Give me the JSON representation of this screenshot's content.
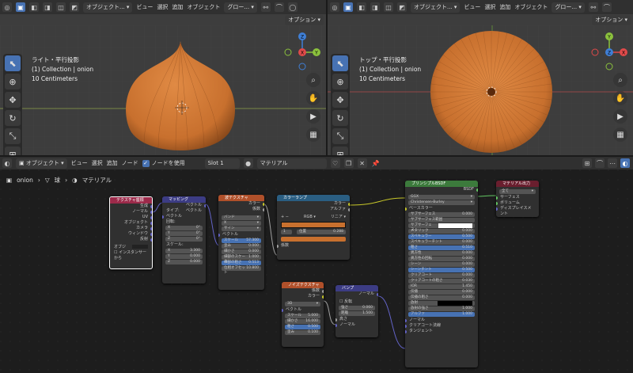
{
  "left_viewport": {
    "header": {
      "mode": "オブジェクト...",
      "menus": [
        "ビュー",
        "選択",
        "追加",
        "オブジェクト"
      ],
      "transform": "グロー...",
      "options": "オプション"
    },
    "info": [
      "ライト・平行投影",
      "(1) Collection | onion",
      "10 Centimeters"
    ],
    "gizmo_axes": [
      "Z",
      "Y",
      "X"
    ]
  },
  "right_viewport": {
    "header": {
      "mode": "オブジェクト...",
      "menus": [
        "ビュー",
        "選択",
        "追加",
        "オブジェクト"
      ],
      "transform": "グロー...",
      "options": "オプション"
    },
    "info": [
      "トップ・平行投影",
      "(1) Collection | onion",
      "10 Centimeters"
    ],
    "gizmo_axes": [
      "Y",
      "Z",
      "X"
    ]
  },
  "node_editor": {
    "header": {
      "mode": "オブジェクト",
      "menus": [
        "ビュー",
        "選択",
        "追加",
        "ノード"
      ],
      "use_nodes_label": "ノードを使用",
      "slot": "Slot 1",
      "material": "マテリアル"
    },
    "breadcrumb": [
      "onion",
      "球",
      "マテリアル"
    ],
    "nodes": {
      "texcoord": {
        "title": "テクスチャ座標",
        "outputs": [
          "生成",
          "ノーマル",
          "UV",
          "オブジェクト",
          "カメラ",
          "ウィンドウ",
          "反射"
        ],
        "object_label": "オブジ",
        "instancer": "インスタンサーから"
      },
      "mapping": {
        "title": "マッピング",
        "out": "ベクトル",
        "type_label": "タイプ:",
        "type_value": "ベクトル",
        "vector": "ベクトル",
        "rotation": "回転:",
        "rot": [
          [
            "X",
            "0°"
          ],
          [
            "Y",
            "0°"
          ],
          [
            "Z",
            "0°"
          ]
        ],
        "scale_label": "スケール:",
        "scale": [
          [
            "X",
            "3.300"
          ],
          [
            "Y",
            "0.000"
          ],
          [
            "Z",
            "0.000"
          ]
        ]
      },
      "wave": {
        "title": "波テクスチャ",
        "outs": [
          "カラー",
          "係数"
        ],
        "band": "バンド",
        "axis": "X",
        "profile": "サイン",
        "vector": "ベクトル",
        "fields": [
          [
            "スケール",
            "57.300"
          ],
          [
            "歪み",
            "0.000"
          ],
          [
            "細かさ",
            "0.000"
          ],
          [
            "細部のスケール",
            "1.000"
          ],
          [
            "細部の粗さ",
            "0.513"
          ],
          [
            "位相オフセット",
            "10.800"
          ]
        ]
      },
      "ramp": {
        "title": "カラーランプ",
        "outs": [
          "カラー",
          "アルファ"
        ],
        "mode": "RGB",
        "interp": "リニア",
        "stop_index": "1",
        "pos_label": "位置",
        "pos_value": "0.288",
        "fac": "係数"
      },
      "noise": {
        "title": "ノイズテクスチャ",
        "outs": [
          "係数",
          "カラー"
        ],
        "dim": "3D",
        "vector": "ベクトル",
        "fields": [
          [
            "スケール",
            "5.000"
          ],
          [
            "細かさ",
            "16.000"
          ],
          [
            "粗さ",
            "0.500"
          ],
          [
            "歪み",
            "0.100"
          ]
        ]
      },
      "bump": {
        "title": "バンプ",
        "out": "ノーマル",
        "invert": "反転",
        "fields": [
          [
            "強さ",
            "0.060"
          ],
          [
            "距離",
            "1.500"
          ]
        ],
        "inputs": [
          "高さ",
          "ノーマル"
        ]
      },
      "bsdf": {
        "title": "プリンシプルBSDF",
        "out": "BSDF",
        "dist": "GGX",
        "sss": "Christensen-Burley",
        "base_color": "ベースカラー",
        "fields": [
          [
            "サブサーフェス",
            "0.000"
          ],
          [
            "サブサーフェス範囲",
            ""
          ],
          [
            "サブサーフェス...",
            ""
          ],
          [
            "メタリック",
            "0.000"
          ],
          [
            "スペキュラー",
            "0.500"
          ],
          [
            "スペキュラーチント",
            "0.000"
          ],
          [
            "粗さ",
            "0.510"
          ],
          [
            "異方性",
            "0.000"
          ],
          [
            "異方性の回転",
            "0.000"
          ],
          [
            "シーン",
            "0.000"
          ],
          [
            "シーンチント",
            "0.500"
          ],
          [
            "クリアコート",
            "0.000"
          ],
          [
            "クリアコートの粗さ",
            "0.030"
          ],
          [
            "IOR",
            "1.450"
          ],
          [
            "伝播",
            "0.000"
          ],
          [
            "伝播の粗さ",
            "0.000"
          ],
          [
            "放射",
            ""
          ],
          [
            "放射の強さ",
            "1.000"
          ],
          [
            "アルファ",
            "1.000"
          ]
        ],
        "inputs": [
          "ノーマル",
          "クリアコート法線",
          "タンジェント"
        ]
      },
      "output": {
        "title": "マテリアル出力",
        "target": "全て",
        "inputs": [
          "サーフェス",
          "ボリューム",
          "ディスプレイスメント"
        ]
      }
    }
  },
  "colors": {
    "accent": "#4772b3",
    "onion": "#c8702e",
    "bsdf_header": "#3c7a3c",
    "tex_header": "#b0502a",
    "vec_header": "#3c3c84",
    "conv_header": "#2a5e82",
    "input_header": "#9c2a4a",
    "output_header": "#6a1e2e"
  }
}
